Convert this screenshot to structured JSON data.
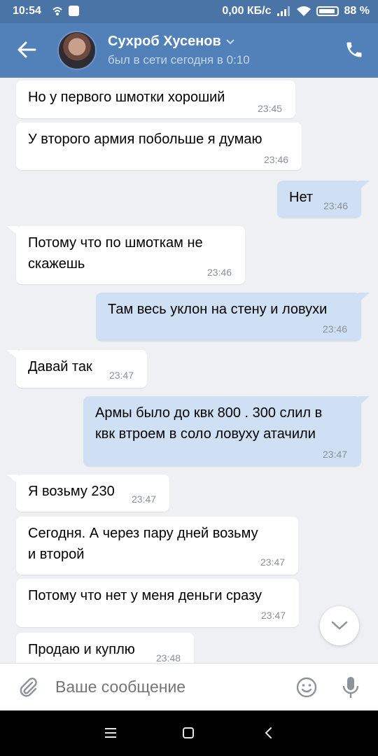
{
  "statusbar": {
    "time": "10:54",
    "network": "0,00 КБ/с",
    "battery": "88 %"
  },
  "header": {
    "contact_name": "Сухроб Хусенов",
    "last_seen": "был в сети сегодня в 0:10"
  },
  "messages": [
    {
      "dir": "in",
      "text": "Но у первого шмотки хороший",
      "time": "23:45"
    },
    {
      "dir": "in",
      "text": "У второго армия побольше я думаю",
      "time": "23:46"
    },
    {
      "dir": "out",
      "text": "Нет",
      "time": "23:46"
    },
    {
      "dir": "in",
      "text": "Потому что по шмоткам не\nскажешь",
      "time": "23:46"
    },
    {
      "dir": "out",
      "text": "Там весь уклон на стену и ловухи",
      "time": "23:46"
    },
    {
      "dir": "in",
      "text": "Давай так",
      "time": "23:47"
    },
    {
      "dir": "out",
      "text": "Армы было до квк 800 . 300 слил в\nквк втроем в соло ловуху атачили",
      "time": "23:47"
    },
    {
      "dir": "in",
      "text": "Я возьму 230",
      "time": "23:47"
    },
    {
      "dir": "in",
      "text": "Сегодня.  А через пару дней возьму\nи второй",
      "time": "23:47"
    },
    {
      "dir": "in",
      "text": "Потому что нет у меня деньги сразу",
      "time": "23:47"
    },
    {
      "dir": "in",
      "text": "Продаю и куплю",
      "time": "23:48"
    }
  ],
  "composer": {
    "placeholder": "Ваше сообщение"
  },
  "icons": {
    "back": "arrow-left-icon",
    "call": "phone-icon",
    "attach": "paperclip-icon",
    "emoji": "smile-icon",
    "voice": "microphone-icon",
    "scroll": "chevron-down-icon"
  },
  "colors": {
    "header": "#5181b8",
    "statusbar": "#4b74a6",
    "incoming_bubble": "#ffffff",
    "outgoing_bubble": "#cfe0f5",
    "chat_background": "#eef0f3"
  }
}
